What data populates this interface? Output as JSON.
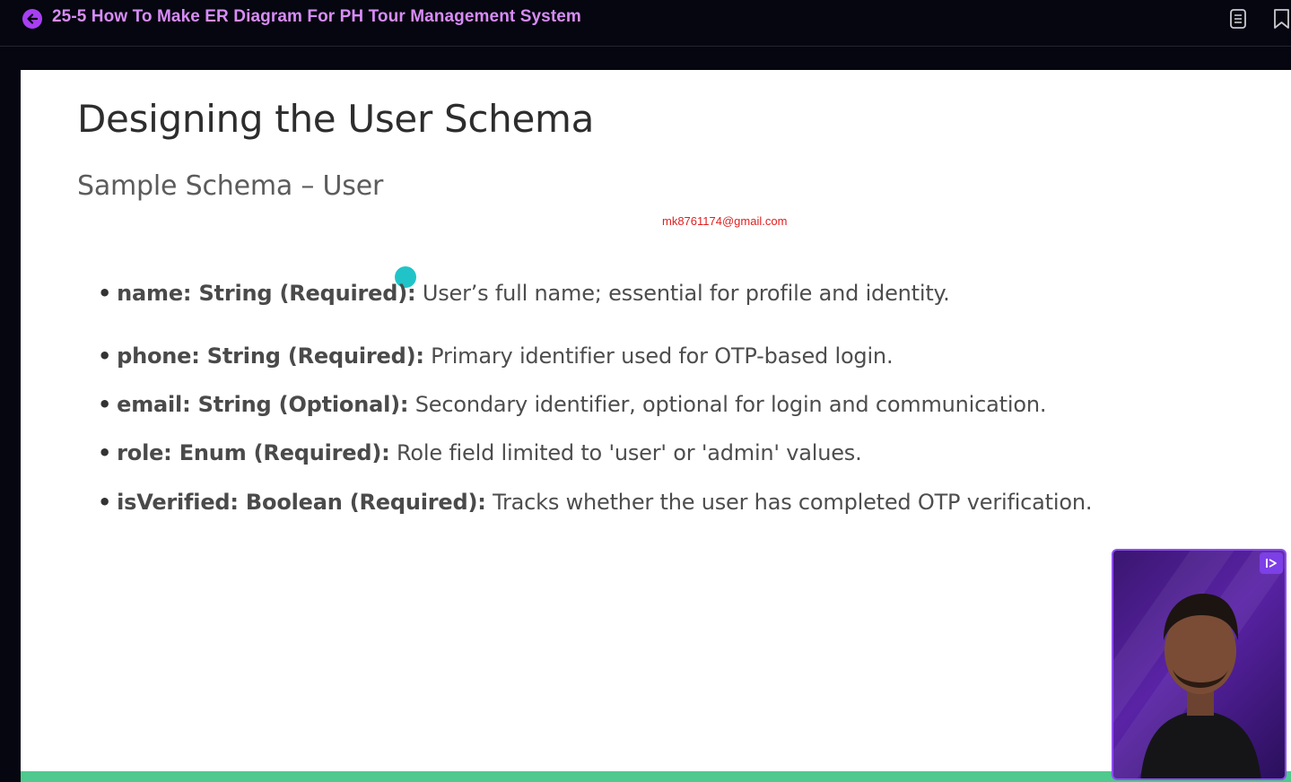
{
  "header": {
    "title": "25-5 How To Make ER Diagram For PH Tour Management System",
    "back_icon": "arrow-left-circle-icon",
    "notes_icon": "notes-icon",
    "bookmark_icon": "bookmark-icon",
    "accent_color": "#a83ff2",
    "title_color": "#d78cf6"
  },
  "slide": {
    "title": "Designing the User Schema",
    "subtitle": "Sample Schema – User",
    "watermark": "mk8761174@gmail.com",
    "bullets": [
      {
        "key": "name: String (Required):",
        "text": "User’s full name; essential for profile and identity."
      },
      {
        "key": "phone: String (Required):",
        "text": "Primary identifier used for OTP-based login."
      },
      {
        "key": "email: String (Optional):",
        "text": "Secondary identifier, optional for login and communication."
      },
      {
        "key": "role: Enum (Required):",
        "text": "Role field limited to 'user' or 'admin' values."
      },
      {
        "key": "isVerified: Boolean (Required):",
        "text": "Tracks whether the user has completed OTP verification."
      }
    ],
    "accent_bar_color": "#4fc98e"
  },
  "webcam": {
    "badge_icon": "presenter-icon",
    "border_color": "#8f4ef0"
  }
}
